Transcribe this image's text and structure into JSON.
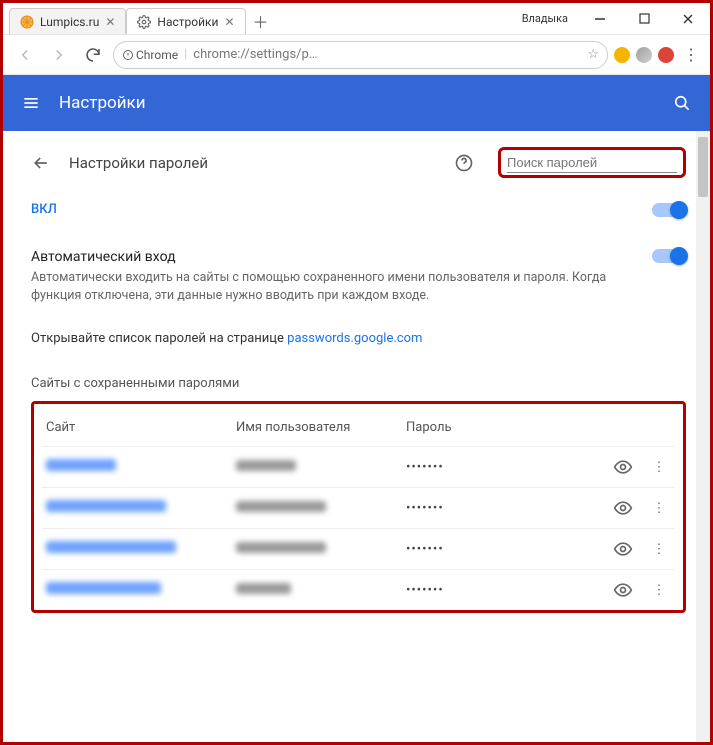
{
  "window": {
    "user_label": "Владыка",
    "tabs": [
      {
        "label": "Lumpics.ru",
        "active": false,
        "icon_color": "#ff9933"
      },
      {
        "label": "Настройки",
        "active": true,
        "icon": "gear"
      }
    ]
  },
  "addressbar": {
    "secure_label": "Chrome",
    "url": "chrome://settings/p…"
  },
  "settings_header": {
    "title": "Настройки"
  },
  "passwords_page": {
    "heading": "Настройки паролей",
    "search_placeholder": "Поиск паролей",
    "toggle_on_label": "ВКЛ",
    "autologin": {
      "title": "Автоматический вход",
      "description": "Автоматически входить на сайты с помощью сохраненного имени пользователя и пароля. Когда функция отключена, эти данные нужно вводить при каждом входе."
    },
    "open_list_prefix": "Открывайте список паролей на странице ",
    "open_list_link": "passwords.google.com",
    "section_label": "Сайты с сохраненными паролями",
    "columns": {
      "site": "Сайт",
      "user": "Имя пользователя",
      "pass": "Пароль"
    },
    "rows": [
      {
        "site_w": 70,
        "user_w": 60,
        "pw": "•••••••"
      },
      {
        "site_w": 120,
        "user_w": 90,
        "pw": "•••••••"
      },
      {
        "site_w": 130,
        "user_w": 90,
        "pw": "•••••••"
      },
      {
        "site_w": 115,
        "user_w": 55,
        "pw": "•••••••"
      }
    ]
  },
  "colors": {
    "accent": "#3367d6",
    "highlight": "#b00000"
  }
}
